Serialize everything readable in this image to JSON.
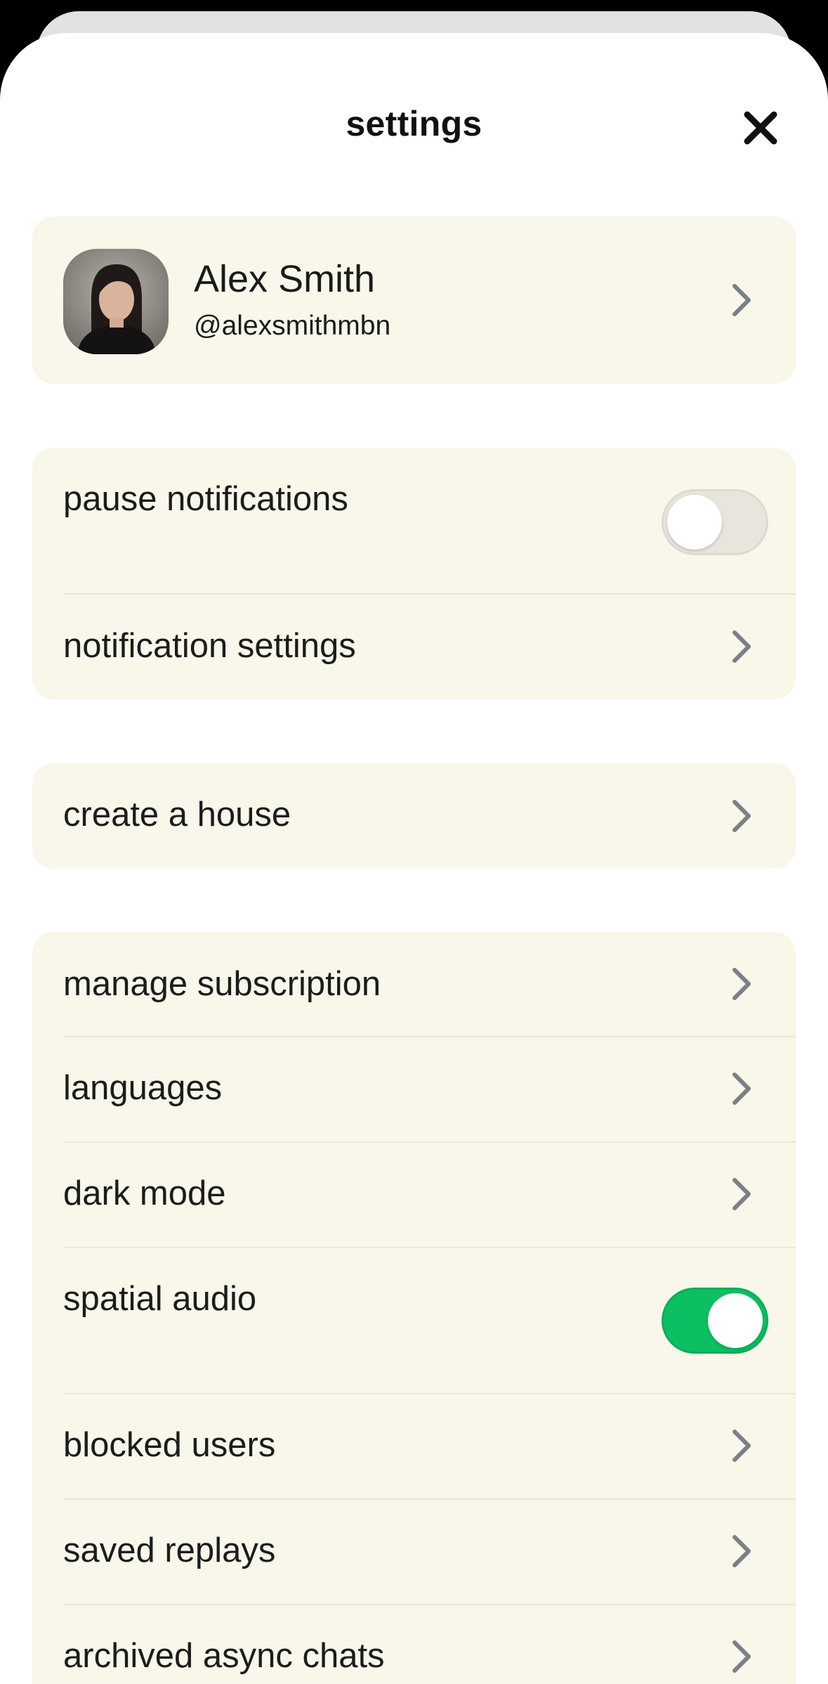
{
  "header": {
    "title": "settings"
  },
  "profile": {
    "name": "Alex Smith",
    "handle": "@alexsmithmbn"
  },
  "notifications": {
    "pause_label": "pause notifications",
    "pause_enabled": false,
    "settings_label": "notification settings"
  },
  "house": {
    "create_label": "create a house"
  },
  "general": {
    "items": [
      {
        "label": "manage subscription"
      },
      {
        "label": "languages"
      },
      {
        "label": "dark mode"
      },
      {
        "label": "spatial audio",
        "toggle": true,
        "enabled": true
      },
      {
        "label": "blocked users"
      },
      {
        "label": "saved replays"
      },
      {
        "label": "archived async chats"
      }
    ]
  },
  "colors": {
    "card_bg": "#f9f6ea",
    "toggle_on": "#0cbf62",
    "toggle_off": "#e7e5dc",
    "chevron": "#7b8085"
  },
  "icons": {
    "close": "close-icon",
    "chevron": "chevron-right-icon"
  }
}
